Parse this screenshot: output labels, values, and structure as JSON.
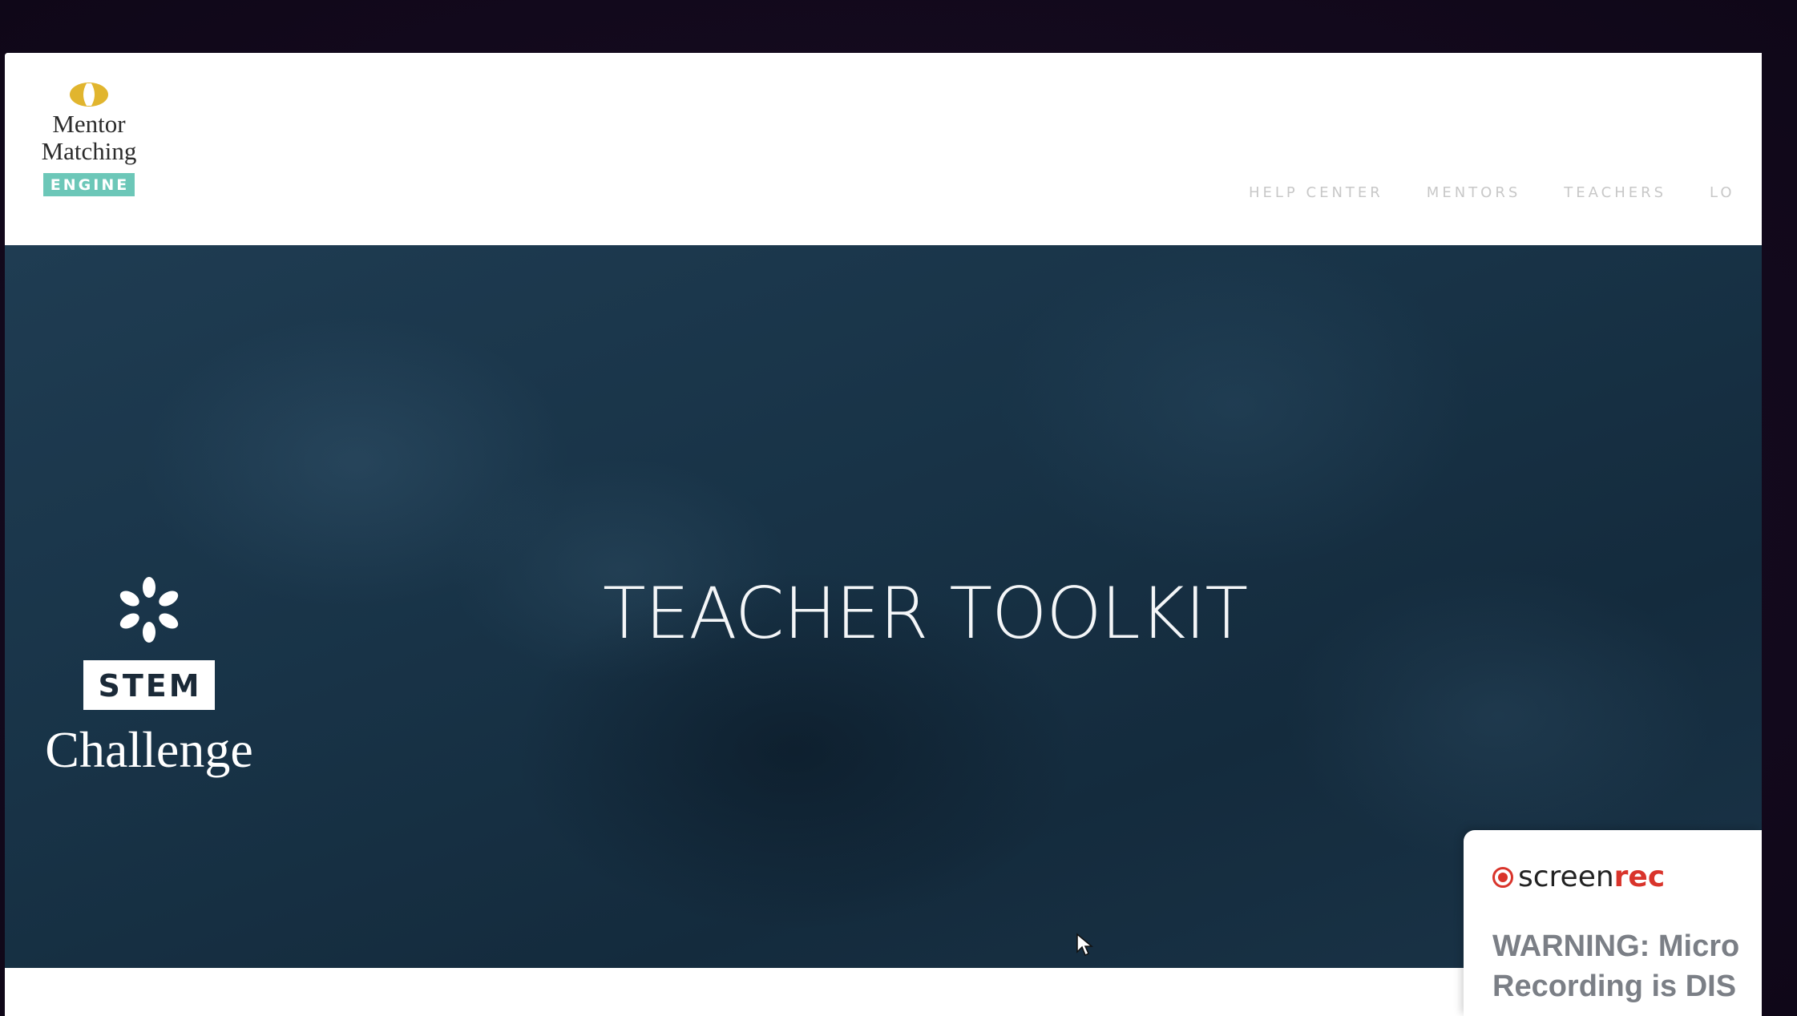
{
  "header": {
    "logo": {
      "line1": "Mentor",
      "line2": "Matching",
      "badge": "ENGINE"
    },
    "nav": [
      {
        "label": "HELP CENTER"
      },
      {
        "label": "MENTORS"
      },
      {
        "label": "TEACHERS"
      },
      {
        "label": "LO"
      }
    ]
  },
  "hero": {
    "stem_logo": {
      "badge": "STEM",
      "subtitle": "Challenge"
    },
    "title": "TEACHER TOOLKIT"
  },
  "recorder": {
    "brand_light": "screen",
    "brand_bold": "rec",
    "warning_line1": "WARNING: Micro",
    "warning_line2": "Recording is DIS"
  },
  "colors": {
    "logo_badge": "#6cc7b8",
    "logo_mark": "#e1b52e",
    "hero_bg": "#183347",
    "recorder_accent": "#d9342b",
    "nav_text": "#c8c8c8"
  }
}
